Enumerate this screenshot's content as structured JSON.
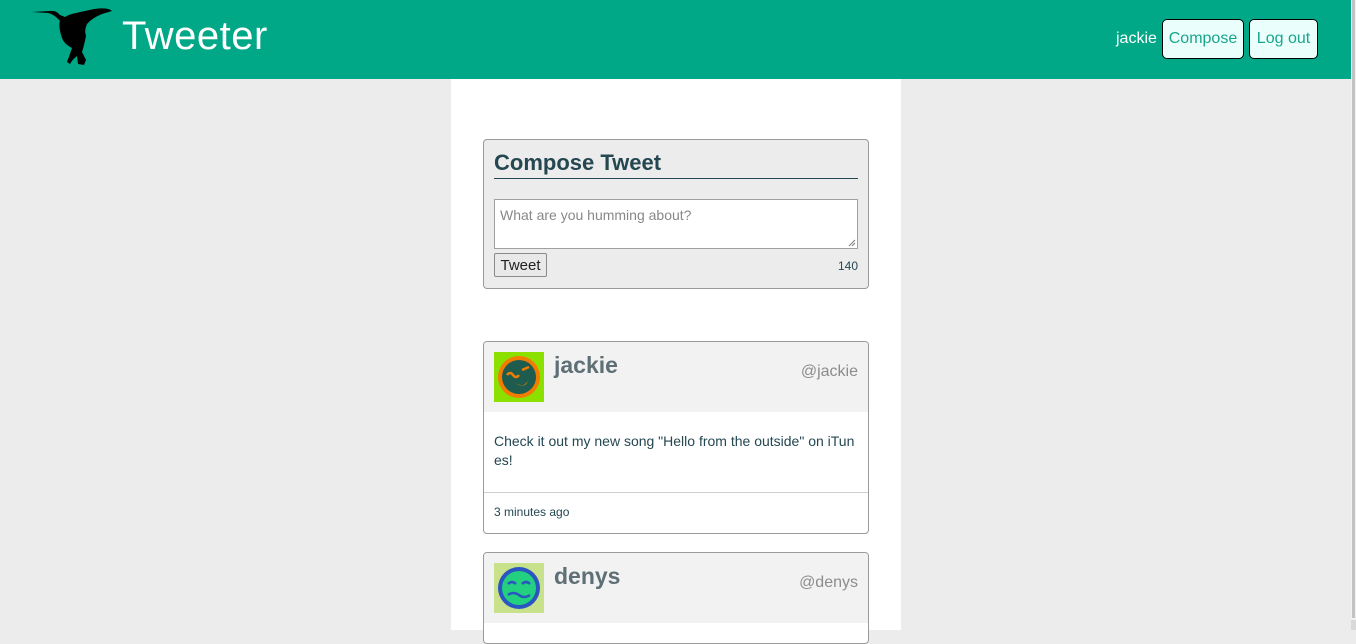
{
  "nav": {
    "brand": "Tweeter",
    "username": "jackie",
    "compose_label": "Compose",
    "logout_label": "Log out"
  },
  "compose": {
    "title": "Compose Tweet",
    "placeholder": "What are you humming about?",
    "tweet_button_label": "Tweet",
    "counter": "140"
  },
  "tweets": [
    {
      "name": "jackie",
      "handle": "@jackie",
      "text": "Check it out my new song \"Hello from the outside\" on iTunes!",
      "time": "3 minutes ago",
      "avatar_bg": "#8be000",
      "avatar_face": "#1e5c4f",
      "avatar_ring": "#f27c00"
    },
    {
      "name": "denys",
      "handle": "@denys",
      "text": "",
      "time": "",
      "avatar_bg": "#c7e28a",
      "avatar_face": "#22d07f",
      "avatar_ring": "#2a56c2"
    }
  ],
  "colors": {
    "brand": "#00a887",
    "page_bg": "#ececec",
    "text": "#244751"
  },
  "icons": {
    "logo": "hummingbird-icon"
  }
}
